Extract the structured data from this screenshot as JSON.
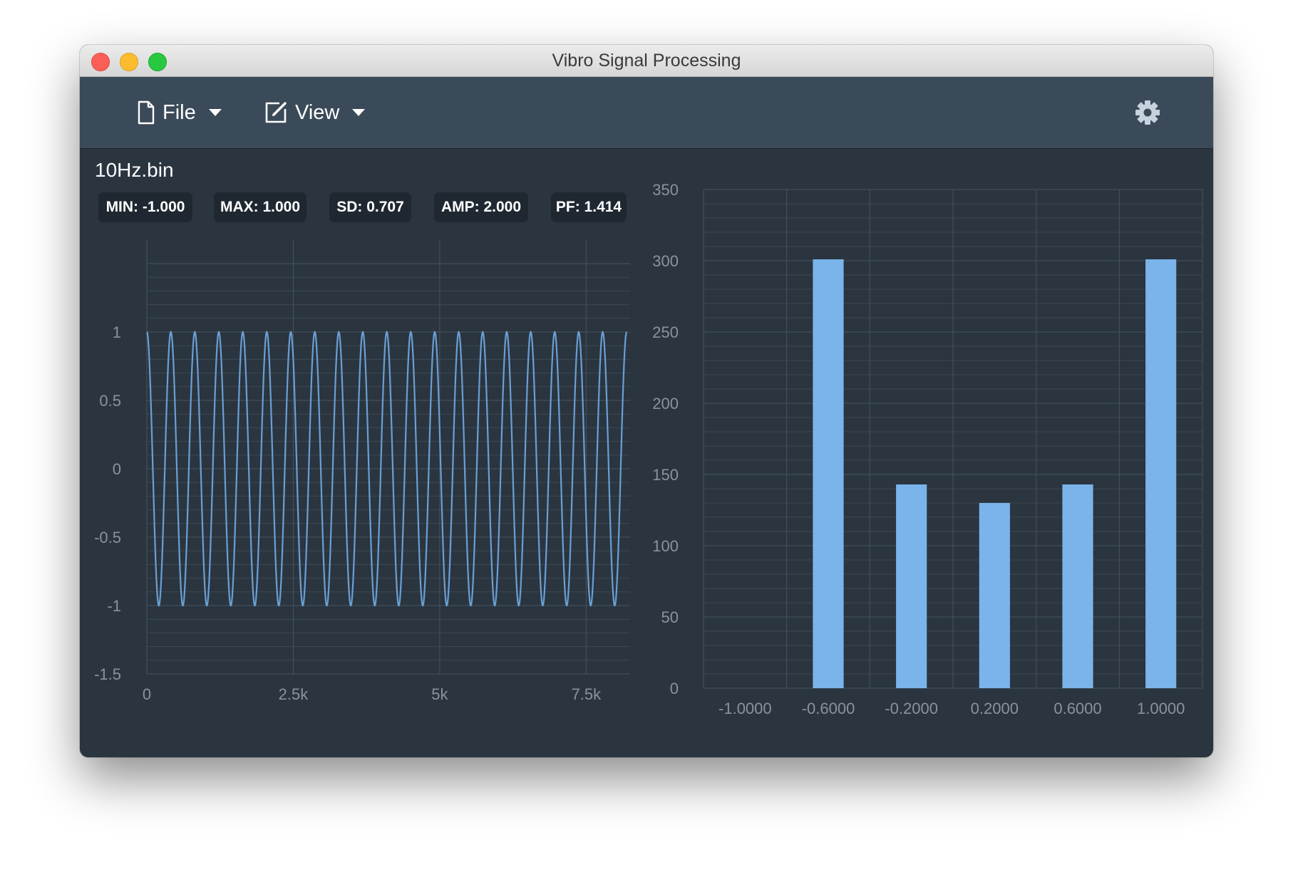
{
  "window": {
    "title": "Vibro Signal Processing"
  },
  "toolbar": {
    "file_label": "File",
    "view_label": "View",
    "icons": [
      "file-icon",
      "edit-icon",
      "caret-down-icon",
      "gear-icon"
    ]
  },
  "file": {
    "name": "10Hz.bin"
  },
  "stats": {
    "min": "MIN: -1.000",
    "max": "MAX: 1.000",
    "sd": "SD: 0.707",
    "amp": "AMP: 2.000",
    "pf": "PF: 1.414"
  },
  "colors": {
    "background": "#2a3540",
    "toolbar": "#3a4a59",
    "signal_line": "#6a9fd4",
    "bar": "#7ab4ea",
    "grid": "#3c4852",
    "tick_label": "#8a939b"
  },
  "chart_data": [
    {
      "type": "line",
      "series": [
        {
          "function": "sine",
          "cycles": 20,
          "amplitude": 1,
          "offset": 0,
          "x_start": 0,
          "x_end": 8192
        }
      ],
      "x_ticks": [
        "0",
        "2.5k",
        "5k",
        "7.5k"
      ],
      "x_tick_values": [
        0,
        2500,
        5000,
        7500
      ],
      "xlim": [
        0,
        8250
      ],
      "y_ticks": [
        "1",
        "0.5",
        "0",
        "-0.5",
        "-1",
        "-1.5"
      ],
      "y_tick_values": [
        1,
        0.5,
        0,
        -0.5,
        -1,
        -1.5
      ],
      "ylim": [
        -1.5,
        1.5
      ],
      "grid": true
    },
    {
      "type": "bar",
      "categories": [
        "-1.0000",
        "-0.6000",
        "-0.2000",
        "0.2000",
        "0.6000",
        "1.0000"
      ],
      "values": [
        0,
        301,
        143,
        130,
        143,
        301
      ],
      "y_ticks": [
        "350",
        "300",
        "250",
        "200",
        "150",
        "100",
        "50",
        "0"
      ],
      "y_tick_values": [
        350,
        300,
        250,
        200,
        150,
        100,
        50,
        0
      ],
      "ylim": [
        0,
        350
      ],
      "grid": true
    }
  ]
}
